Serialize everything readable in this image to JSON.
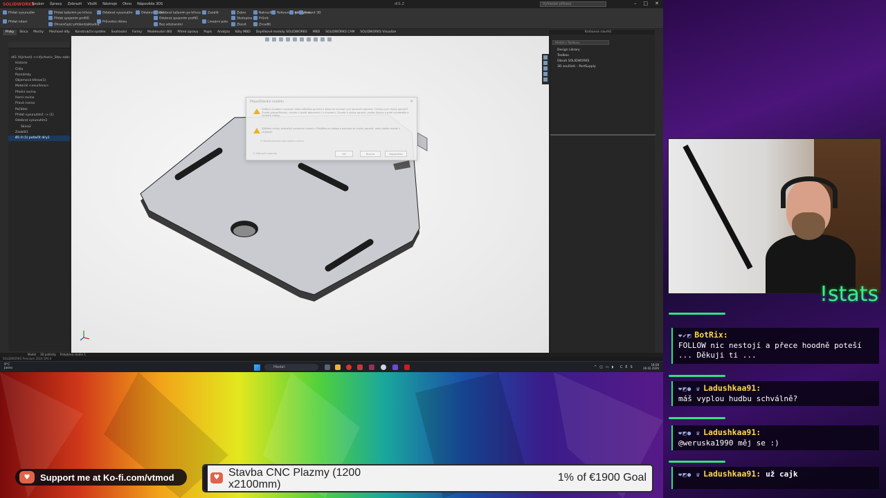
{
  "solidworks": {
    "logo": "SOLIDWORKS",
    "menu": [
      "Soubor",
      "Úpravy",
      "Zobrazit",
      "Vložit",
      "Nástroje",
      "Okno",
      "Nápověda 3DS"
    ],
    "doc_title": "díl1.Z",
    "search_placeholder": "Vyhledat příkazy",
    "ribbon": [
      {
        "label": "Přidat vysunutím"
      },
      {
        "label": "Přidat rotací"
      },
      {
        "label": "Přidat tažením po křivce"
      },
      {
        "label": "Přidat spojením profilů"
      },
      {
        "label": "Ohraničující přidání/základna"
      },
      {
        "label": "Odebrat vysunutím"
      },
      {
        "label": "Průvodce děrou"
      },
      {
        "label": "Odebrat rotací"
      },
      {
        "label": "Odebrat tažením po křivce"
      },
      {
        "label": "Odebrat spojením profilů"
      },
      {
        "label": "Bez odstranění"
      },
      {
        "label": "Zaoblit"
      },
      {
        "label": "Lineární pole"
      },
      {
        "label": "Žebro"
      },
      {
        "label": "Skořepina"
      },
      {
        "label": "Zkosit"
      },
      {
        "label": "Nakreslit"
      },
      {
        "label": "Průnik"
      },
      {
        "label": "Zrcadlit"
      },
      {
        "label": "Referenční geometrie"
      },
      {
        "label": "Křivky"
      },
      {
        "label": "Instant 3D"
      }
    ],
    "tabs": [
      "Prvky",
      "Skica",
      "Plochy",
      "Plechové díly",
      "Konstrukční systém",
      "Svařování",
      "Formy",
      "Modelování dílů",
      "Přímé úpravy",
      "Popis",
      "Analýza",
      "Kóty MBD",
      "Doplňkové moduly SOLIDWORKS",
      "MBD",
      "SOLIDWORKS CAM",
      "SOLIDWORKS Visualize"
    ],
    "tree": [
      {
        "text": "díl1 (Výchozí) <<Výchozí>_Stav zobrazení",
        "selected": false
      },
      {
        "text": "Historie",
        "selected": false
      },
      {
        "text": "Čidla",
        "selected": false
      },
      {
        "text": "Poznámky",
        "selected": false
      },
      {
        "text": "Objemová tělesa(1)",
        "selected": false
      },
      {
        "text": "Materiál <neurčeno>",
        "selected": false
      },
      {
        "text": "Přední rovina",
        "selected": false
      },
      {
        "text": "Horní rovina",
        "selected": false
      },
      {
        "text": "Pravá rovina",
        "selected": false
      },
      {
        "text": "Počátek",
        "selected": false
      },
      {
        "text": "Přidat vysunutím1 -> (1)",
        "selected": false
      },
      {
        "text": "Odebrat vysunutím1",
        "selected": false
      },
      {
        "text": "Skica2",
        "selected": false
      },
      {
        "text": "Zaoblit1",
        "selected": false
      },
      {
        "text": "Ø1.0 (1) potlačit díry1",
        "selected": true
      }
    ],
    "task_pane": {
      "title": "Knihovna návrhů",
      "search_placeholder": "Hledat v Toolboxu",
      "items": [
        "Design Library",
        "Toolbox",
        "Obsah SOLIDWORKS",
        "3D součásti – PartSupply"
      ]
    },
    "status_tabs": [
      "Model",
      "3D pohledy",
      "Pohybová studie 1"
    ],
    "status_line": "SOLIDWORKS Premium 2024 SP4.0"
  },
  "dialog": {
    "title": "Přepočítávání modelu",
    "warning1": "Došlo k chybám v jednom nebo několika prvcích a skica se nemusí nyní správně zobrazit. Chcete nyní chyby opravit? Zvolte přepočítávání, chcete-li uložit dokument i s chybami. Chcete-li chyby opravit, zvolte Storno a poté vyhledejte a opravte chyby.",
    "warning2": "Zjištěné chyby zabraňují vytvoření modelu. Přejděte na dialog a pokuste se chyby opravit, nebo uložte model s chybami.",
    "check1": "Nezobrazovat tuto zprávu znovu",
    "check2": "Zobrazit hodnoty",
    "btn_ok": "OK",
    "btn_cancel": "Storno",
    "btn_help": "Nápověda"
  },
  "taskbar": {
    "weather": "9°C",
    "weather_desc": "Jasno",
    "search": "Hledat",
    "lang": "CES",
    "time": "18:08",
    "date": "26.02.2026"
  },
  "overlay": {
    "stats_cmd": "!stats",
    "chat": [
      {
        "user": "BotRix:",
        "text": "FOLLOW nic nestojí a přece hoodně poteší ... Děkuji ti ..."
      },
      {
        "user": "Ladushkaa91:",
        "text": "máš vyplou hudbu schválně?"
      },
      {
        "user": "Ladushkaa91:",
        "text": "@weruska1990 měj se :)"
      },
      {
        "user": "Ladushkaa91:",
        "text": "už cajk"
      }
    ],
    "kofi_text": "Support me at Ko-fi.com/vtmod",
    "goal_title": "Stavba CNC Plazmy (1200 x2100mm)",
    "goal_progress": "1% of €1900 Goal",
    "goal_fraction": 0.01
  }
}
